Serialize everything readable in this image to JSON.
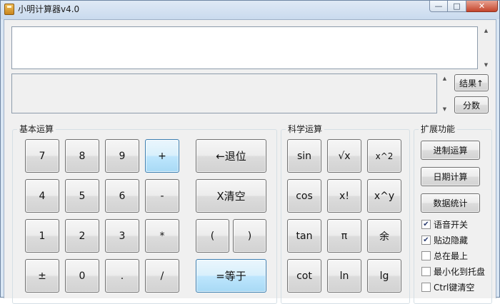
{
  "window": {
    "title": "小明计算器v4.0",
    "controls": {
      "minimize": "—",
      "maximize": "□",
      "close": "✕"
    }
  },
  "display": {
    "expression_value": "",
    "result_value": "",
    "result_up_label": "结果↑",
    "fraction_label": "分数"
  },
  "basic": {
    "label": "基本运算",
    "keys": [
      "7",
      "8",
      "9",
      "+",
      "4",
      "5",
      "6",
      "-",
      "1",
      "2",
      "3",
      "*",
      "±",
      "0",
      ".",
      "/"
    ],
    "backspace_label": "←退位",
    "clear_label": "X清空",
    "lparen_label": "(",
    "rparen_label": ")",
    "equals_label": "=等于"
  },
  "science": {
    "label": "科学运算",
    "keys": [
      "sin",
      "√x",
      "x^2",
      "cos",
      "x!",
      "x^y",
      "tan",
      "π",
      "余",
      "cot",
      "ln",
      "lg"
    ]
  },
  "extend": {
    "label": "扩展功能",
    "buttons": [
      "进制运算",
      "日期计算",
      "数据统计"
    ],
    "options": [
      {
        "label": "语音开关",
        "checked": true
      },
      {
        "label": "贴边隐藏",
        "checked": true
      },
      {
        "label": "总在最上",
        "checked": false
      },
      {
        "label": "最小化到托盘",
        "checked": false
      },
      {
        "label": "Ctrl键清空",
        "checked": false
      }
    ]
  },
  "colors": {
    "highlight_key": "#bee6fd",
    "window_frame": "#d9e6f4"
  }
}
